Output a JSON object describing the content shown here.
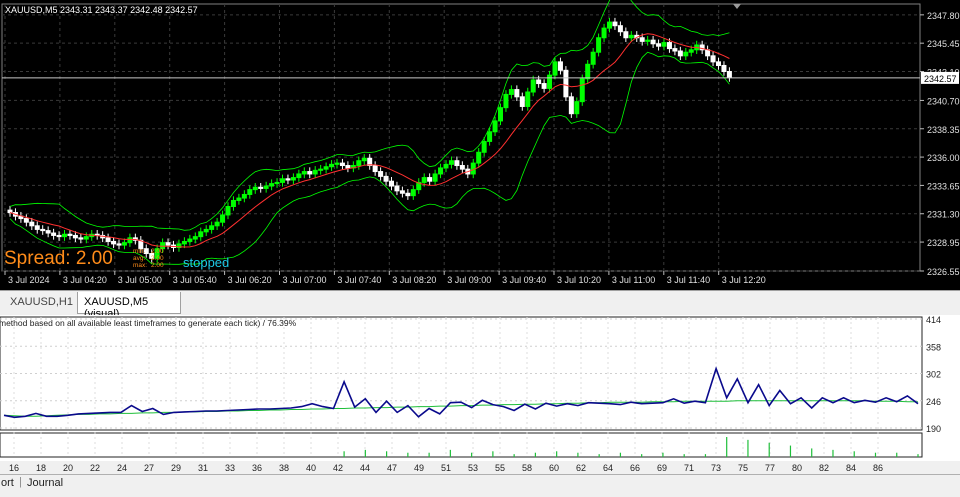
{
  "chart": {
    "title": "XAUUSD,M5  2343.31 2343.37 2342.48 2342.57",
    "bid_price": "2342.57",
    "spread_label": "Spread: 2.00",
    "stopped_label": "stopped",
    "colors": {
      "background": "#000000",
      "bull": "#00ff00",
      "bear": "#ffffff",
      "ma": "#ff3030",
      "bands": "#00ff00",
      "spread": "#ff8c1a",
      "stopped": "#1ec8e6"
    },
    "price_ticks": [
      "2347.80",
      "2345.45",
      "2343.10",
      "2340.70",
      "2338.35",
      "2336.00",
      "2333.65",
      "2331.30",
      "2328.95",
      "2326.55"
    ],
    "time_ticks": [
      "3 Jul 2024",
      "3 Jul 04:20",
      "3 Jul 05:00",
      "3 Jul 05:40",
      "3 Jul 06:20",
      "3 Jul 07:00",
      "3 Jul 07:40",
      "3 Jul 08:20",
      "3 Jul 09:00",
      "3 Jul 09:40",
      "3 Jul 10:20",
      "3 Jul 11:00",
      "3 Jul 11:40",
      "3 Jul 12:20"
    ],
    "chart_data": {
      "type": "candlestick",
      "ylim": [
        2326.55,
        2348.7
      ],
      "closes": [
        2331.4,
        2331.1,
        2330.9,
        2330.6,
        2330.3,
        2330.0,
        2329.9,
        2329.7,
        2329.5,
        2329.4,
        2329.6,
        2329.5,
        2329.3,
        2329.2,
        2329.4,
        2329.6,
        2329.5,
        2329.3,
        2329.0,
        2328.8,
        2328.7,
        2328.9,
        2329.3,
        2329.1,
        2328.4,
        2328.0,
        2327.6,
        2328.4,
        2328.9,
        2328.7,
        2328.5,
        2328.8,
        2329.0,
        2329.2,
        2329.4,
        2329.8,
        2330.0,
        2330.3,
        2330.6,
        2331.2,
        2331.9,
        2332.4,
        2332.6,
        2332.9,
        2333.3,
        2333.5,
        2333.4,
        2333.6,
        2333.8,
        2333.9,
        2334.2,
        2334.1,
        2334.3,
        2334.6,
        2334.8,
        2334.6,
        2334.9,
        2335.0,
        2335.2,
        2335.4,
        2335.5,
        2335.3,
        2335.1,
        2335.3,
        2335.7,
        2335.9,
        2335.3,
        2334.8,
        2334.4,
        2334.0,
        2333.6,
        2333.2,
        2333.0,
        2332.8,
        2333.3,
        2333.9,
        2334.3,
        2334.0,
        2334.6,
        2335.1,
        2335.4,
        2335.7,
        2335.3,
        2335.0,
        2334.6,
        2335.5,
        2336.4,
        2337.3,
        2338.1,
        2339.0,
        2340.1,
        2341.2,
        2341.6,
        2341.0,
        2340.2,
        2341.4,
        2342.4,
        2342.1,
        2341.7,
        2342.8,
        2343.9,
        2343.2,
        2341.0,
        2339.6,
        2340.6,
        2342.5,
        2343.7,
        2344.7,
        2345.9,
        2346.7,
        2347.2,
        2346.9,
        2346.4,
        2345.9,
        2346.1,
        2345.9,
        2345.6,
        2345.7,
        2345.4,
        2345.2,
        2345.5,
        2345.0,
        2344.8,
        2344.4,
        2344.7,
        2344.9,
        2345.3,
        2344.9,
        2344.4,
        2343.9,
        2343.6,
        2343.1,
        2342.6
      ],
      "bid": 2342.57
    },
    "legend_rows": [
      {
        "label": "min:",
        "value": "2.00"
      },
      {
        "label": "avg:",
        "value": "2.00"
      },
      {
        "label": "max:",
        "value": "2.00"
      }
    ]
  },
  "tabs": [
    {
      "label": "XAUUSD,H1",
      "active": false
    },
    {
      "label": "XAUUSD,M5 (visual)",
      "active": true
    }
  ],
  "optimization": {
    "header_text": "method based on all available least timeframes to generate each tick) / 76.39%",
    "y_ticks": [
      "414",
      "358",
      "302",
      "246",
      "190"
    ],
    "x_ticks": [
      "16",
      "18",
      "20",
      "22",
      "24",
      "27",
      "29",
      "31",
      "33",
      "36",
      "38",
      "40",
      "42",
      "44",
      "47",
      "49",
      "51",
      "53",
      "55",
      "58",
      "60",
      "62",
      "64",
      "66",
      "69",
      "71",
      "73",
      "75",
      "77",
      "80",
      "82",
      "84",
      "86"
    ],
    "colors": {
      "balance": "#0a0a8c",
      "equity": "#1fbf3a",
      "volume": "#1fbf3a"
    },
    "chart_data": {
      "type": "line",
      "series": [
        {
          "values": [
            216,
            212,
            214,
            220,
            214,
            214,
            216,
            219,
            220,
            221,
            222,
            222,
            236,
            224,
            230,
            218,
            222,
            223,
            224,
            225,
            225,
            226,
            227,
            228,
            229,
            229,
            230,
            231,
            234,
            240,
            234,
            230,
            285,
            233,
            250,
            222,
            245,
            222,
            236,
            213,
            230,
            219,
            242,
            243,
            232,
            247,
            238,
            234,
            226,
            239,
            229,
            241,
            235,
            240,
            236,
            242,
            241,
            240,
            238,
            243,
            240,
            241,
            242,
            250,
            241,
            245,
            242,
            312,
            252,
            291,
            242,
            279,
            236,
            267,
            240,
            252,
            231,
            252,
            242,
            252,
            242,
            247,
            243,
            252,
            244,
            256,
            240
          ]
        },
        {
          "values": [
            216,
            215,
            214,
            214,
            215,
            216,
            217,
            218,
            218,
            219,
            219,
            220,
            220,
            221,
            221,
            222,
            222,
            223,
            223,
            224,
            224,
            225,
            225,
            226,
            226,
            227,
            227,
            228,
            228,
            229,
            229,
            230,
            230,
            231,
            231,
            232,
            232,
            233,
            233,
            234,
            234,
            235,
            235,
            236,
            236,
            237,
            237,
            238,
            238,
            239,
            239,
            240,
            240,
            241,
            241,
            242,
            242,
            243,
            243,
            243,
            243,
            244,
            244,
            244,
            245,
            245,
            245,
            245,
            245,
            246,
            246,
            246,
            246,
            246,
            246,
            246,
            246,
            246,
            246,
            246,
            246,
            246,
            245,
            245,
            245,
            244,
            244
          ]
        }
      ],
      "volume": [
        0,
        0,
        0,
        0,
        0,
        0,
        0,
        0,
        0,
        0,
        0,
        0,
        0,
        0,
        0,
        0,
        0,
        0,
        0,
        0,
        0,
        0,
        0,
        0,
        0,
        0,
        0,
        0,
        0,
        0,
        0,
        0,
        4,
        0,
        5,
        0,
        4,
        0,
        3,
        0,
        3,
        0,
        5,
        0,
        3,
        0,
        4,
        0,
        2,
        0,
        3,
        0,
        4,
        0,
        3,
        0,
        2,
        0,
        3,
        0,
        2,
        0,
        3,
        0,
        2,
        0,
        2,
        0,
        14,
        0,
        12,
        0,
        10,
        0,
        8,
        0,
        6,
        0,
        5,
        0,
        4,
        0,
        3,
        0,
        3,
        0,
        2
      ],
      "ylim": [
        190,
        414
      ]
    }
  },
  "bottom_tabs": [
    {
      "label": "ort"
    },
    {
      "label": "Journal"
    }
  ]
}
